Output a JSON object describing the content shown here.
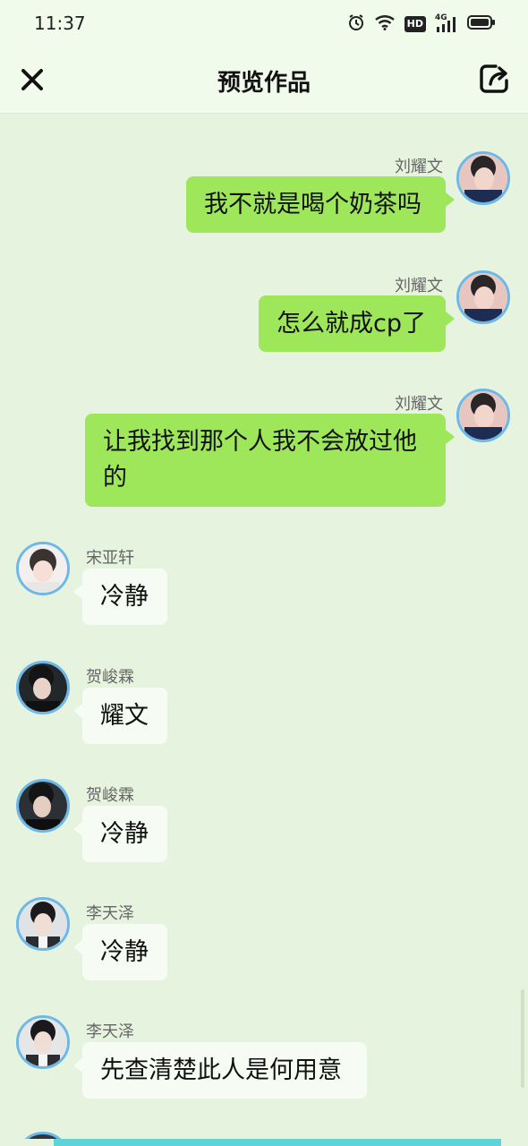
{
  "status_bar": {
    "time": "11:37",
    "icons": [
      "alarm-icon",
      "wifi-icon",
      "hd-icon",
      "signal-4g-icon",
      "battery-icon"
    ],
    "hd_label": "HD",
    "network_label": "4G"
  },
  "header": {
    "title": "预览作品",
    "close_icon": "close-icon",
    "share_icon": "share-icon"
  },
  "messages": [
    {
      "direction": "out",
      "sender": "刘耀文",
      "text": "我不就是喝个奶茶吗"
    },
    {
      "direction": "out",
      "sender": "刘耀文",
      "text": "怎么就成cp了"
    },
    {
      "direction": "out",
      "sender": "刘耀文",
      "text": "让我找到那个人我不会放过他的"
    },
    {
      "direction": "in",
      "sender": "宋亚轩",
      "text": "冷静"
    },
    {
      "direction": "in",
      "sender": "贺峻霖",
      "text": "耀文"
    },
    {
      "direction": "in",
      "sender": "贺峻霖",
      "text": "冷静"
    },
    {
      "direction": "in",
      "sender": "李天泽",
      "text": "冷静"
    },
    {
      "direction": "in",
      "sender": "李天泽",
      "text": "先查清楚此人是何用意"
    }
  ],
  "colors": {
    "outgoing_bubble": "#9ee65a",
    "incoming_bubble": "#f6fcf3",
    "chat_background": "#e6f4df",
    "avatar_border": "#6cb8e8"
  }
}
